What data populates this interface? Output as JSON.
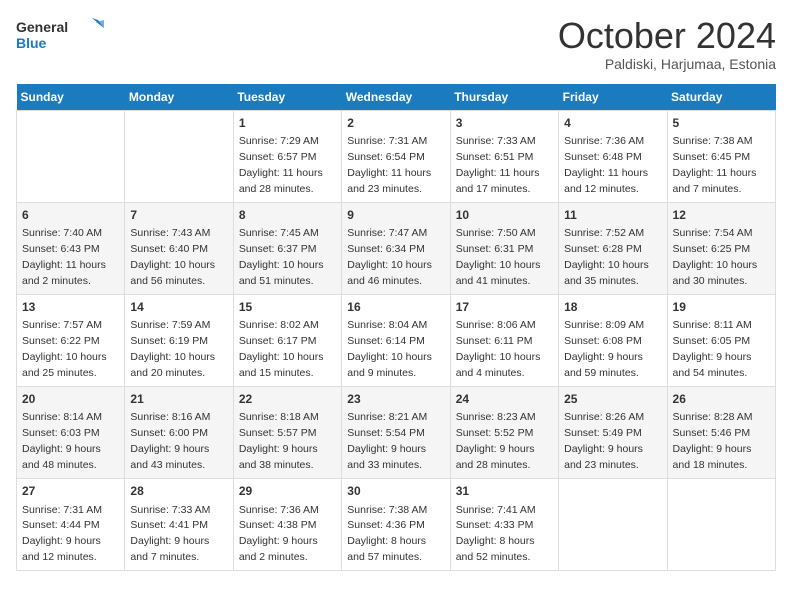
{
  "header": {
    "logo_text_general": "General",
    "logo_text_blue": "Blue",
    "month": "October 2024",
    "location": "Paldiski, Harjumaa, Estonia"
  },
  "weekdays": [
    "Sunday",
    "Monday",
    "Tuesday",
    "Wednesday",
    "Thursday",
    "Friday",
    "Saturday"
  ],
  "weeks": [
    [
      {
        "day": "",
        "info": ""
      },
      {
        "day": "",
        "info": ""
      },
      {
        "day": "1",
        "info": "Sunrise: 7:29 AM\nSunset: 6:57 PM\nDaylight: 11 hours and 28 minutes."
      },
      {
        "day": "2",
        "info": "Sunrise: 7:31 AM\nSunset: 6:54 PM\nDaylight: 11 hours and 23 minutes."
      },
      {
        "day": "3",
        "info": "Sunrise: 7:33 AM\nSunset: 6:51 PM\nDaylight: 11 hours and 17 minutes."
      },
      {
        "day": "4",
        "info": "Sunrise: 7:36 AM\nSunset: 6:48 PM\nDaylight: 11 hours and 12 minutes."
      },
      {
        "day": "5",
        "info": "Sunrise: 7:38 AM\nSunset: 6:45 PM\nDaylight: 11 hours and 7 minutes."
      }
    ],
    [
      {
        "day": "6",
        "info": "Sunrise: 7:40 AM\nSunset: 6:43 PM\nDaylight: 11 hours and 2 minutes."
      },
      {
        "day": "7",
        "info": "Sunrise: 7:43 AM\nSunset: 6:40 PM\nDaylight: 10 hours and 56 minutes."
      },
      {
        "day": "8",
        "info": "Sunrise: 7:45 AM\nSunset: 6:37 PM\nDaylight: 10 hours and 51 minutes."
      },
      {
        "day": "9",
        "info": "Sunrise: 7:47 AM\nSunset: 6:34 PM\nDaylight: 10 hours and 46 minutes."
      },
      {
        "day": "10",
        "info": "Sunrise: 7:50 AM\nSunset: 6:31 PM\nDaylight: 10 hours and 41 minutes."
      },
      {
        "day": "11",
        "info": "Sunrise: 7:52 AM\nSunset: 6:28 PM\nDaylight: 10 hours and 35 minutes."
      },
      {
        "day": "12",
        "info": "Sunrise: 7:54 AM\nSunset: 6:25 PM\nDaylight: 10 hours and 30 minutes."
      }
    ],
    [
      {
        "day": "13",
        "info": "Sunrise: 7:57 AM\nSunset: 6:22 PM\nDaylight: 10 hours and 25 minutes."
      },
      {
        "day": "14",
        "info": "Sunrise: 7:59 AM\nSunset: 6:19 PM\nDaylight: 10 hours and 20 minutes."
      },
      {
        "day": "15",
        "info": "Sunrise: 8:02 AM\nSunset: 6:17 PM\nDaylight: 10 hours and 15 minutes."
      },
      {
        "day": "16",
        "info": "Sunrise: 8:04 AM\nSunset: 6:14 PM\nDaylight: 10 hours and 9 minutes."
      },
      {
        "day": "17",
        "info": "Sunrise: 8:06 AM\nSunset: 6:11 PM\nDaylight: 10 hours and 4 minutes."
      },
      {
        "day": "18",
        "info": "Sunrise: 8:09 AM\nSunset: 6:08 PM\nDaylight: 9 hours and 59 minutes."
      },
      {
        "day": "19",
        "info": "Sunrise: 8:11 AM\nSunset: 6:05 PM\nDaylight: 9 hours and 54 minutes."
      }
    ],
    [
      {
        "day": "20",
        "info": "Sunrise: 8:14 AM\nSunset: 6:03 PM\nDaylight: 9 hours and 48 minutes."
      },
      {
        "day": "21",
        "info": "Sunrise: 8:16 AM\nSunset: 6:00 PM\nDaylight: 9 hours and 43 minutes."
      },
      {
        "day": "22",
        "info": "Sunrise: 8:18 AM\nSunset: 5:57 PM\nDaylight: 9 hours and 38 minutes."
      },
      {
        "day": "23",
        "info": "Sunrise: 8:21 AM\nSunset: 5:54 PM\nDaylight: 9 hours and 33 minutes."
      },
      {
        "day": "24",
        "info": "Sunrise: 8:23 AM\nSunset: 5:52 PM\nDaylight: 9 hours and 28 minutes."
      },
      {
        "day": "25",
        "info": "Sunrise: 8:26 AM\nSunset: 5:49 PM\nDaylight: 9 hours and 23 minutes."
      },
      {
        "day": "26",
        "info": "Sunrise: 8:28 AM\nSunset: 5:46 PM\nDaylight: 9 hours and 18 minutes."
      }
    ],
    [
      {
        "day": "27",
        "info": "Sunrise: 7:31 AM\nSunset: 4:44 PM\nDaylight: 9 hours and 12 minutes."
      },
      {
        "day": "28",
        "info": "Sunrise: 7:33 AM\nSunset: 4:41 PM\nDaylight: 9 hours and 7 minutes."
      },
      {
        "day": "29",
        "info": "Sunrise: 7:36 AM\nSunset: 4:38 PM\nDaylight: 9 hours and 2 minutes."
      },
      {
        "day": "30",
        "info": "Sunrise: 7:38 AM\nSunset: 4:36 PM\nDaylight: 8 hours and 57 minutes."
      },
      {
        "day": "31",
        "info": "Sunrise: 7:41 AM\nSunset: 4:33 PM\nDaylight: 8 hours and 52 minutes."
      },
      {
        "day": "",
        "info": ""
      },
      {
        "day": "",
        "info": ""
      }
    ]
  ]
}
